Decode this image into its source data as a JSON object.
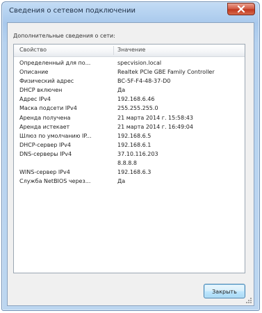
{
  "window": {
    "title": "Сведения о сетевом подключении"
  },
  "group_label": "Дополнительные сведения о сети:",
  "table": {
    "columns": [
      "Свойство",
      "Значение"
    ],
    "rows": [
      {
        "property": "Определенный для по...",
        "value": "specvision.local"
      },
      {
        "property": "Описание",
        "value": "Realtek PCIe GBE Family Controller"
      },
      {
        "property": "Физический адрес",
        "value": "BC-5F-F4-48-37-D0"
      },
      {
        "property": "DHCP включен",
        "value": "Да"
      },
      {
        "property": "Адрес IPv4",
        "value": "192.168.6.46"
      },
      {
        "property": "Маска подсети IPv4",
        "value": "255.255.255.0"
      },
      {
        "property": "Аренда получена",
        "value": "21 марта 2014 г. 15:58:43"
      },
      {
        "property": "Аренда истекает",
        "value": "21 марта 2014 г. 16:49:04"
      },
      {
        "property": "Шлюз по умолчанию IP...",
        "value": "192.168.6.5"
      },
      {
        "property": "DHCP-сервер IPv4",
        "value": "192.168.6.1"
      },
      {
        "property": "DNS-серверы IPv4",
        "value": "37.10.116.203"
      },
      {
        "property": "",
        "value": "8.8.8.8"
      },
      {
        "property": "WINS-сервер IPv4",
        "value": "192.168.6.3"
      },
      {
        "property": "Служба NetBIOS через...",
        "value": "Да"
      }
    ]
  },
  "buttons": {
    "close_label": "Закрыть"
  },
  "icons": {
    "title_close": "close-icon",
    "resize": "resize-grip-icon"
  }
}
